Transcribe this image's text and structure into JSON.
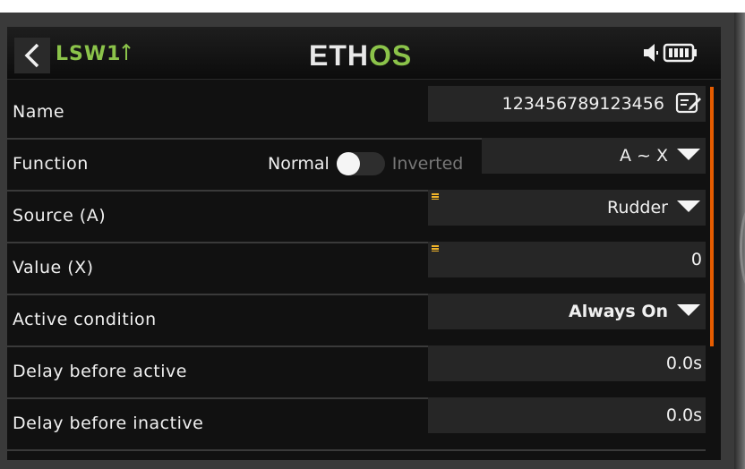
{
  "header": {
    "title": "LSW1",
    "logo_part1": "ETH",
    "logo_part2": "OS"
  },
  "rows": {
    "name": {
      "label": "Name",
      "value": "123456789123456"
    },
    "function": {
      "label": "Function",
      "toggle_off_label": "Normal",
      "toggle_on_label": "Inverted",
      "toggle_on": false,
      "value": "A ~ X"
    },
    "source": {
      "label": "Source (A)",
      "value": "Rudder"
    },
    "value": {
      "label": "Value (X)",
      "value": "0"
    },
    "active_condition": {
      "label": "Active condition",
      "value": "Always On"
    },
    "delay_active": {
      "label": "Delay before active",
      "value": "0.0s"
    },
    "delay_inactive": {
      "label": "Delay before inactive",
      "value": "0.0s"
    }
  },
  "colors": {
    "accent_green": "#8bc34a",
    "scroll_orange": "#e65c00",
    "source_marker": "#f0b429"
  },
  "icons": [
    "back-arrow-icon",
    "switch-edge-icon",
    "speaker-icon",
    "battery-icon",
    "edit-icon",
    "dropdown-arrow-icon"
  ]
}
